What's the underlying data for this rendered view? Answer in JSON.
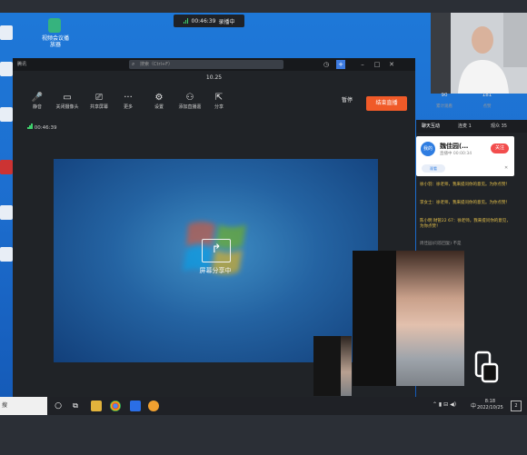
{
  "recording": {
    "time": "00:46:39",
    "status": "录播中"
  },
  "desktop": {
    "icons": [
      "视频会议播放器",
      ""
    ]
  },
  "window": {
    "title": "腾讯",
    "search_placeholder": "搜索（Ctrl+F）"
  },
  "meeting": {
    "title": "10.25",
    "timer": "00:46:39"
  },
  "toolbar": {
    "items": [
      {
        "label": "静音",
        "icon": "microphone-icon"
      },
      {
        "label": "关闭摄像头",
        "icon": "camera-icon"
      },
      {
        "label": "共享屏幕",
        "icon": "share-screen-icon"
      },
      {
        "label": "更多",
        "icon": "more-icon"
      },
      {
        "label": "设置",
        "icon": "gear-icon"
      },
      {
        "label": "添加直播嘉",
        "icon": "add-user-icon"
      },
      {
        "label": "分享",
        "icon": "export-icon"
      }
    ],
    "pause_label": "暂停",
    "end_label": "结束直播"
  },
  "share": {
    "text": "屏幕分享中"
  },
  "stats": [
    {
      "value": "90",
      "label": "累计观看"
    },
    {
      "value": "181",
      "label": "点赞"
    }
  ],
  "panel": {
    "tabs": [
      "聊天互动",
      "连麦 1",
      "观众 35"
    ],
    "host_card": {
      "badge": "我的",
      "name": "魏佳园(…",
      "sub": "直播中 00:00:34",
      "follow": "关注",
      "chip": "观看"
    },
    "chat": [
      "徐小羽：徐老师，我来提问你的意见。为你点赞！",
      "李女士：徐老师，我来提问你的意见。为你点赞！",
      "陈小明 财管22 67：徐老师，我来提问你的意见，为你点赞！",
      "周佳园(问答回复)    不是"
    ]
  },
  "taskbar": {
    "search": "搜",
    "time": "8:18",
    "date": "2022/10/25",
    "ime": "中"
  },
  "colors": {
    "accent": "#f05a28",
    "desktop": "#1e78d8",
    "panel": "#202327"
  }
}
